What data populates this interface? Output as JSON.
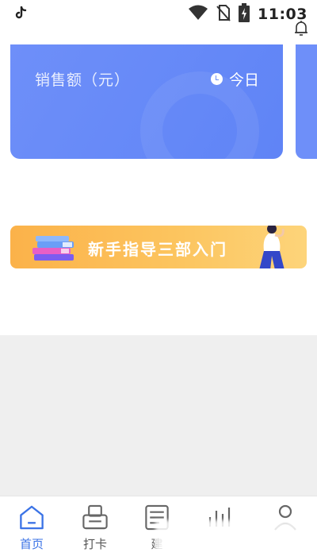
{
  "status_bar": {
    "app_icon": "tiktok-icon",
    "time": "11:03",
    "icons": [
      "wifi-icon",
      "no-sim-icon",
      "battery-charging-icon"
    ]
  },
  "header": {
    "bell_icon": "bell-icon"
  },
  "sales_card": {
    "title": "销售额（元）",
    "period_label": "今日",
    "period_icon": "clock-icon",
    "colors": {
      "card": "#6e8ff9"
    }
  },
  "guide_banner": {
    "text": "新手指导三部入门",
    "colors": {
      "start": "#fbb24a",
      "end": "#fdd47a"
    }
  },
  "bottom_nav": {
    "items": [
      {
        "label": "首页",
        "icon": "home-icon",
        "active": true
      },
      {
        "label": "打卡",
        "icon": "clock-in-printer-icon",
        "active": false
      },
      {
        "label": "建",
        "icon": "document-icon",
        "active": false
      },
      {
        "label": "",
        "icon": "chart-icon",
        "active": false
      },
      {
        "label": "",
        "icon": "profile-icon",
        "active": false
      }
    ],
    "colors": {
      "active": "#3b73e6",
      "inactive": "#555555"
    }
  }
}
